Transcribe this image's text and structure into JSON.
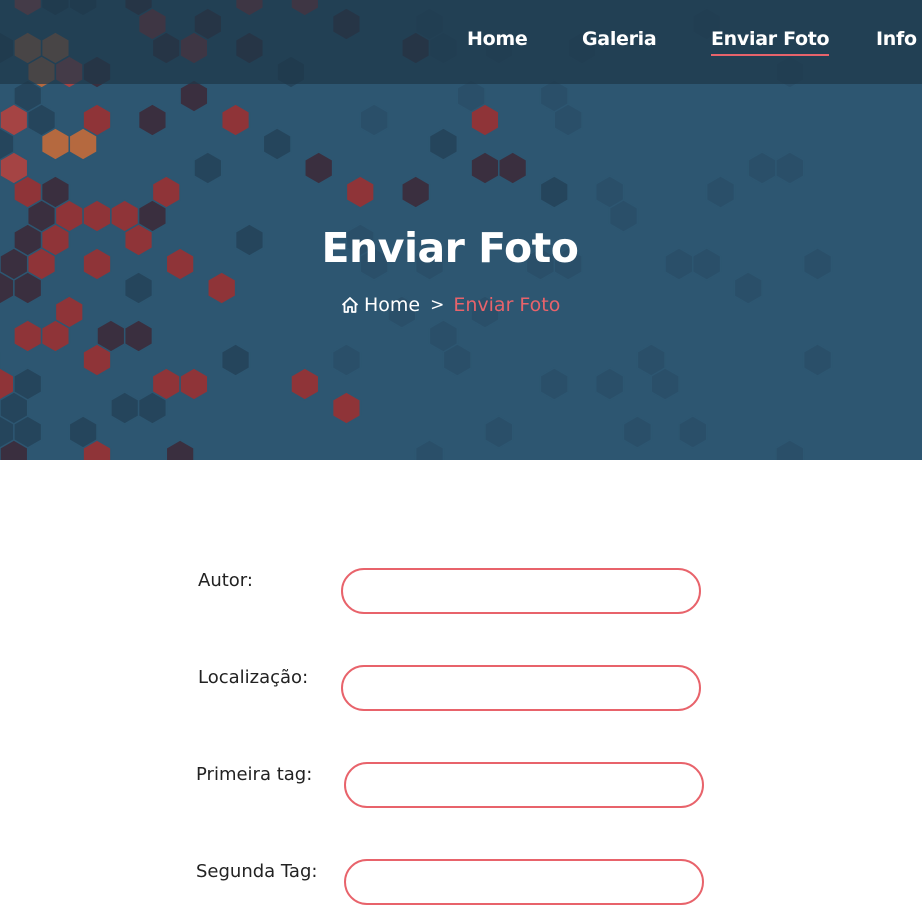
{
  "nav": {
    "items": [
      {
        "label": "Home",
        "active": false
      },
      {
        "label": "Galeria",
        "active": false
      },
      {
        "label": "Enviar Foto",
        "active": true
      },
      {
        "label": "Info A",
        "active": false
      }
    ]
  },
  "hero": {
    "title": "Enviar Foto",
    "breadcrumb": {
      "home_icon": "home-icon",
      "home": "Home",
      "separator": ">",
      "current": "Enviar Foto"
    }
  },
  "form": {
    "fields": [
      {
        "label": "Autor:",
        "value": ""
      },
      {
        "label": "Localização:",
        "value": ""
      },
      {
        "label": "Primeira tag:",
        "value": ""
      },
      {
        "label": "Segunda Tag:",
        "value": ""
      }
    ]
  },
  "colors": {
    "accent": "#e8636b",
    "hero_bg": "#2d5671",
    "navbar_bg": "#1e374a"
  }
}
